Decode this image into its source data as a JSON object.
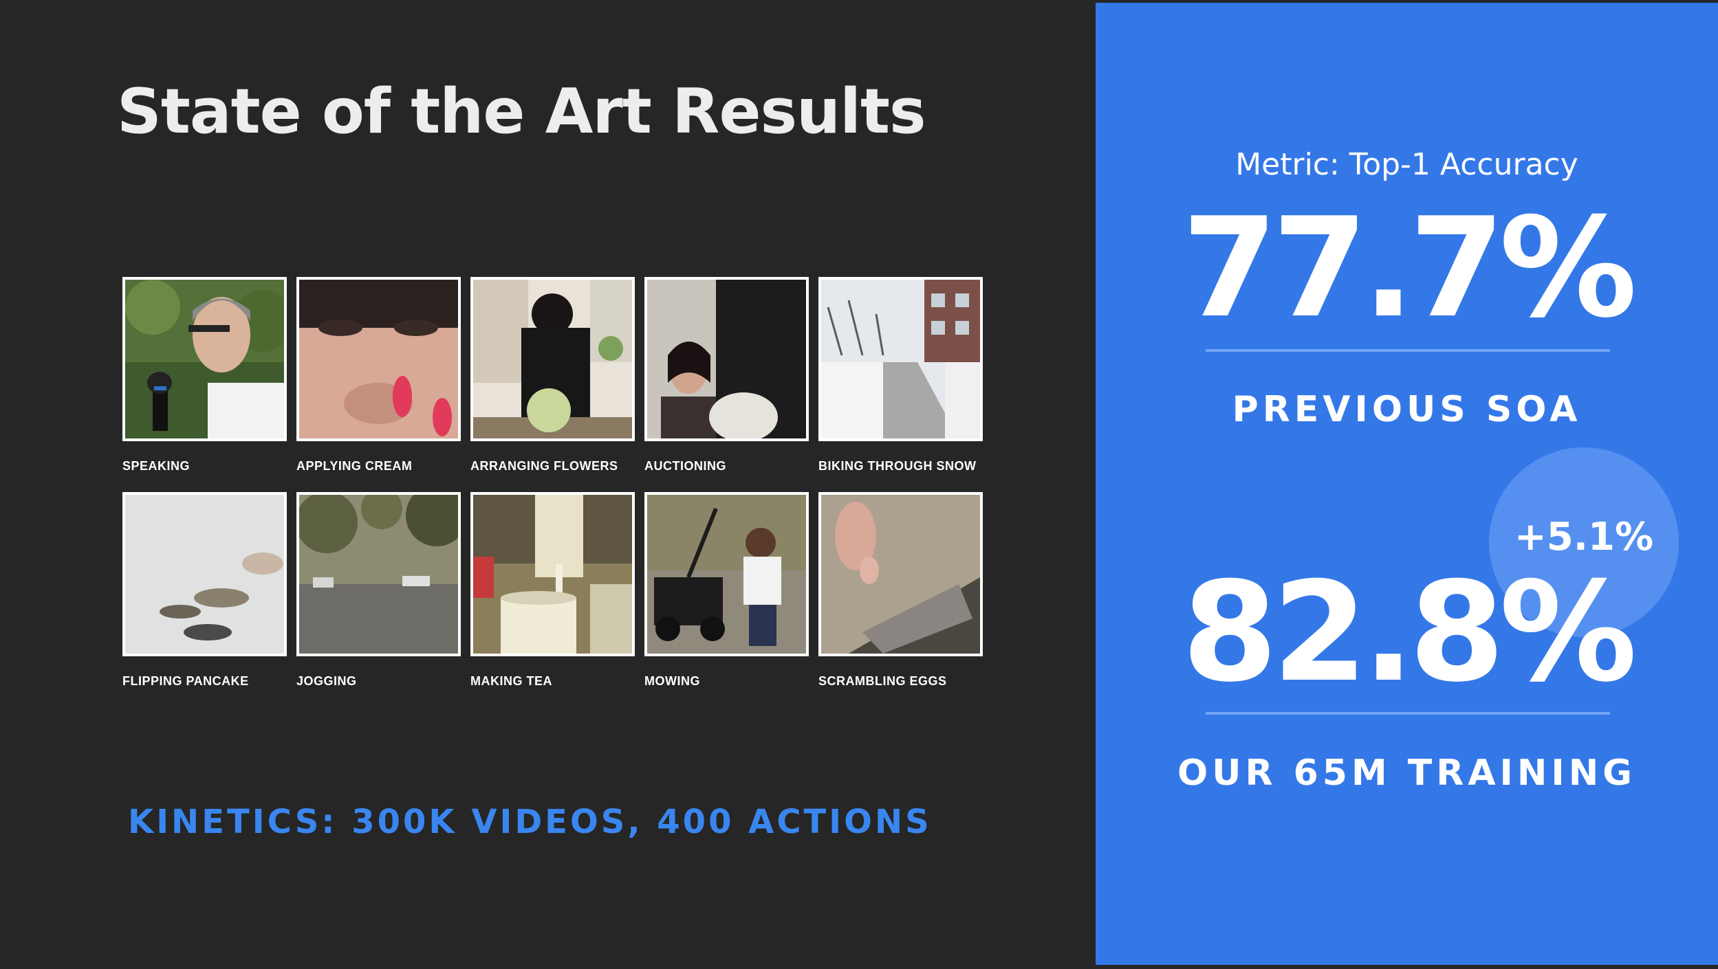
{
  "slide": {
    "title": "State of the Art Results",
    "caption": "KINETICS: 300K VIDEOS, 400 ACTIONS"
  },
  "grid": {
    "tiles": [
      {
        "label": "SPEAKING",
        "icon": "speaking-thumbnail-icon"
      },
      {
        "label": "APPLYING CREAM",
        "icon": "applying-cream-thumbnail-icon"
      },
      {
        "label": "ARRANGING FLOWERS",
        "icon": "arranging-flowers-thumbnail-icon"
      },
      {
        "label": "AUCTIONING",
        "icon": "auctioning-thumbnail-icon"
      },
      {
        "label": "BIKING THROUGH SNOW",
        "icon": "biking-through-snow-thumbnail-icon"
      },
      {
        "label": "FLIPPING PANCAKE",
        "icon": "flipping-pancake-thumbnail-icon"
      },
      {
        "label": "JOGGING",
        "icon": "jogging-thumbnail-icon"
      },
      {
        "label": "MAKING TEA",
        "icon": "making-tea-thumbnail-icon"
      },
      {
        "label": "MOWING",
        "icon": "mowing-thumbnail-icon"
      },
      {
        "label": "SCRAMBLING EGGS",
        "icon": "scrambling-eggs-thumbnail-icon"
      }
    ]
  },
  "panel": {
    "metric": "Metric: Top-1 Accuracy",
    "previous_value": "77.7%",
    "previous_label": "PREVIOUS SOA",
    "improvement": "+5.1%",
    "our_value": "82.8%",
    "our_label": "OUR 65M TRAINING"
  },
  "colors": {
    "background": "#262626",
    "panel": "#3478e8",
    "bubble": "#5590f0",
    "caption": "#3a86f0",
    "divider": "#6fa4f2"
  }
}
